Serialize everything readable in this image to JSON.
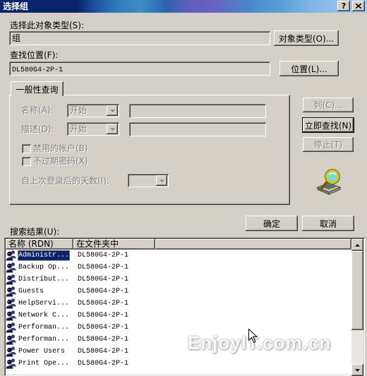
{
  "window": {
    "title": "选择组",
    "help_label": "?"
  },
  "object_type": {
    "label": "选择此对象类型(S):",
    "value": "组",
    "button_label": "对象类型(O)..."
  },
  "location": {
    "label": "查找位置(F):",
    "value": "DL580G4-2P-1",
    "button_label": "位置(L)..."
  },
  "query": {
    "tab_label": "一般性查询",
    "name": {
      "label": "名称(A):",
      "mode": "开始"
    },
    "description": {
      "label": "描述(D):",
      "mode": "开始"
    },
    "disabled_accounts": {
      "label": "禁用的帐户(B)",
      "checked": false
    },
    "non_expiring_password": {
      "label": "不过期密码(X)",
      "checked": false
    },
    "days_since_logon": {
      "label": "自上次登录后的天数(I):"
    }
  },
  "actions": {
    "columns_label": "列(C)...",
    "find_now_label": "立即查找(N)",
    "stop_label": "停止(T)",
    "ok_label": "确定",
    "cancel_label": "取消"
  },
  "results": {
    "label": "搜索结果(U):",
    "columns": [
      "名称 (RDN)",
      "在文件夹中"
    ],
    "rows": [
      {
        "name": "Administr...",
        "folder": "DL580G4-2P-1",
        "selected": true
      },
      {
        "name": "Backup Op...",
        "folder": "DL580G4-2P-1",
        "selected": false
      },
      {
        "name": "Distribut...",
        "folder": "DL580G4-2P-1",
        "selected": false
      },
      {
        "name": "Guests",
        "folder": "DL580G4-2P-1",
        "selected": false
      },
      {
        "name": "HelpServi...",
        "folder": "DL580G4-2P-1",
        "selected": false
      },
      {
        "name": "Network C...",
        "folder": "DL580G4-2P-1",
        "selected": false
      },
      {
        "name": "Performan...",
        "folder": "DL580G4-2P-1",
        "selected": false
      },
      {
        "name": "Performan...",
        "folder": "DL580G4-2P-1",
        "selected": false
      },
      {
        "name": "Power Users",
        "folder": "DL580G4-2P-1",
        "selected": false
      },
      {
        "name": "Print Ope...",
        "folder": "DL580G4-2P-1",
        "selected": false
      }
    ]
  },
  "watermark": "EnjoyIT.com.cn",
  "icons": {
    "close": "close-icon",
    "row": "group-icon",
    "search": "search-computers-icon",
    "dropdown": "chevron-down-icon",
    "cursor": "mouse-cursor-icon"
  },
  "colors": {
    "face": "#d4d0c8",
    "selection": "#0a246a",
    "title_bar": "#0a246a",
    "disabled_text": "#808080"
  }
}
